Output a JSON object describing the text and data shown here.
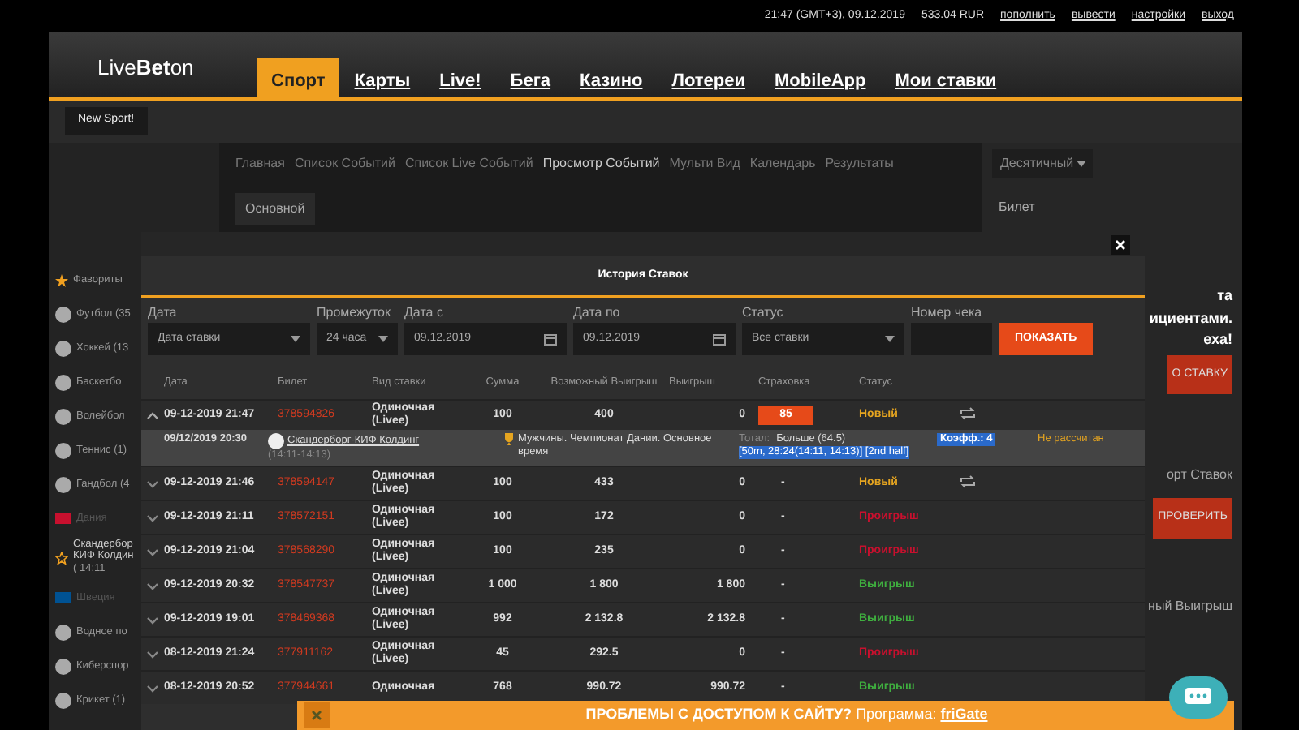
{
  "top_bar": {
    "datetime": "21:47 (GMT+3), 09.12.2019",
    "balance": "533.04 RUR",
    "links": [
      "пополнить",
      "вывести",
      "настройки",
      "выход"
    ]
  },
  "header": {
    "logo": "Live**Bet**on",
    "tabs": [
      {
        "label": "Спорт",
        "selected": true
      },
      {
        "label": "Карты",
        "selected": false
      },
      {
        "label": "Live!",
        "selected": false
      },
      {
        "label": "Бега",
        "selected": false
      },
      {
        "label": "Казино",
        "selected": false
      },
      {
        "label": "Лотереи",
        "selected": false
      },
      {
        "label": "MobileApp",
        "selected": false
      },
      {
        "label": "Мои ставки",
        "selected": false
      }
    ]
  },
  "sub_bar": {
    "button": "New Sport!"
  },
  "sidebar": {
    "items": [
      {
        "kind": "heading",
        "label": "Фавориты"
      },
      {
        "kind": "sport",
        "label": "Футбол (35"
      },
      {
        "kind": "sport",
        "label": "Хоккей (13"
      },
      {
        "kind": "sport",
        "label": "Баскетбо"
      },
      {
        "kind": "sport",
        "label": "Волейбол"
      },
      {
        "kind": "sport",
        "label": "Теннис (1)"
      },
      {
        "kind": "sport",
        "label": "Гандбол (4"
      },
      {
        "kind": "country",
        "label": "Дания",
        "color": "#c8102e"
      },
      {
        "kind": "event",
        "label": "Скандербор КИФ Колдин",
        "time": "( 14:11"
      },
      {
        "kind": "country",
        "label": "Швеция",
        "color": "#005293"
      },
      {
        "kind": "sport",
        "label": "Водное по"
      },
      {
        "kind": "sport",
        "label": "Киберспор"
      },
      {
        "kind": "sport",
        "label": "Крикет (1)"
      }
    ]
  },
  "breadcrumbs": [
    "Главная",
    "Список Событий",
    "Список Live Событий",
    "Просмотр Событий",
    "Мульти Вид",
    "Календарь",
    "Результаты"
  ],
  "content_tab": "Основной",
  "right_panel": {
    "odds_format": "Десятичный",
    "ticket_title": "Билет",
    "promo_fragments": [
      "та",
      "ициентами.",
      "еха!"
    ],
    "stake_button": "О СТАВКУ",
    "import_label": "орт Ставок",
    "check_button": "ПРОВЕРИТЬ",
    "win_label": "ный Выигрыш"
  },
  "modal": {
    "title": "История Ставок",
    "filters": [
      {
        "label": "Дата",
        "kind": "select",
        "value": "Дата ставки"
      },
      {
        "label": "Промежуток",
        "kind": "select",
        "value": "24 часа"
      },
      {
        "label": "Дата с",
        "kind": "date",
        "value": "09.12.2019"
      },
      {
        "label": "Дата по",
        "kind": "date",
        "value": "09.12.2019"
      },
      {
        "label": "Статус",
        "kind": "select",
        "value": "Все ставки"
      },
      {
        "label": "Номер чека",
        "kind": "input"
      }
    ],
    "show_button": "ПОКАЗАТЬ",
    "columns": [
      "Дата",
      "Билет",
      "Вид ставки",
      "Сумма",
      "Возможный Выигрыш",
      "Выигрыш",
      "Страховка",
      "Статус"
    ],
    "rows": [
      {
        "date": "09-12-2019 21:47",
        "ticket": "378594826",
        "type": "Одиночная (Livee)",
        "sum": "100",
        "possible": "400",
        "win": "0",
        "insurance": "85",
        "insurance_button": true,
        "status": "Новый",
        "color": "#e6a520",
        "repeat": true,
        "expanded": true,
        "detail": {
          "date": "09/12/2019 20:30",
          "event": "Скандерборг-КИФ Колдинг",
          "time": "(14:11-14:13)",
          "league": "Мужчины. Чемпионат Дании. Основное время",
          "bet_label": "Тотал:",
          "bet": "Больше (64.5)",
          "bet_extra": "[50m, 28:24(14:11, 14:13)] [2nd half]",
          "coef": "Коэфф.: 4",
          "status": "Не рассчитан"
        }
      },
      {
        "date": "09-12-2019 21:46",
        "ticket": "378594147",
        "type": "Одиночная (Livee)",
        "sum": "100",
        "possible": "433",
        "win": "0",
        "insurance": "-",
        "insurance_button": false,
        "status": "Новый",
        "color": "#e6a520",
        "repeat": true,
        "expanded": false
      },
      {
        "date": "09-12-2019 21:11",
        "ticket": "378572151",
        "type": "Одиночная (Livee)",
        "sum": "100",
        "possible": "172",
        "win": "0",
        "insurance": "-",
        "insurance_button": false,
        "status": "Проигрыш",
        "color": "#c8102e",
        "repeat": false,
        "expanded": false
      },
      {
        "date": "09-12-2019 21:04",
        "ticket": "378568290",
        "type": "Одиночная (Livee)",
        "sum": "100",
        "possible": "235",
        "win": "0",
        "insurance": "-",
        "insurance_button": false,
        "status": "Проигрыш",
        "color": "#c8102e",
        "repeat": false,
        "expanded": false
      },
      {
        "date": "09-12-2019 20:32",
        "ticket": "378547737",
        "type": "Одиночная (Livee)",
        "sum": "1 000",
        "possible": "1 800",
        "win": "1 800",
        "insurance": "-",
        "insurance_button": false,
        "status": "Выигрыш",
        "color": "#3fae3f",
        "repeat": false,
        "expanded": false
      },
      {
        "date": "09-12-2019 19:01",
        "ticket": "378469368",
        "type": "Одиночная (Livee)",
        "sum": "992",
        "possible": "2 132.8",
        "win": "2 132.8",
        "insurance": "-",
        "insurance_button": false,
        "status": "Выигрыш",
        "color": "#3fae3f",
        "repeat": false,
        "expanded": false
      },
      {
        "date": "08-12-2019 21:24",
        "ticket": "377911162",
        "type": "Одиночная (Livee)",
        "sum": "45",
        "possible": "292.5",
        "win": "0",
        "insurance": "-",
        "insurance_button": false,
        "status": "Проигрыш",
        "color": "#c8102e",
        "repeat": false,
        "expanded": false
      },
      {
        "date": "08-12-2019 20:52",
        "ticket": "377944661",
        "type": "Одиночная",
        "sum": "768",
        "possible": "990.72",
        "win": "990.72",
        "insurance": "-",
        "insurance_button": false,
        "status": "Выигрыш",
        "color": "#3fae3f",
        "repeat": false,
        "expanded": false
      }
    ]
  },
  "banner": {
    "text": "**ПРОБЛЕМЫ С ДОСТУПОМ К САЙТУ?** Программа:",
    "link": "friGate"
  }
}
